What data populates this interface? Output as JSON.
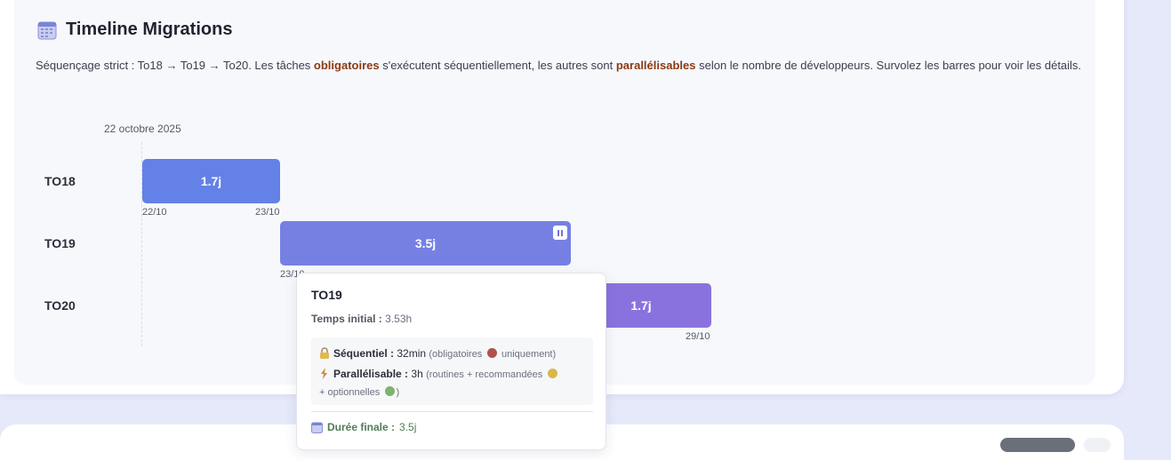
{
  "header": {
    "title": "Timeline Migrations",
    "icon": "calendar-icon"
  },
  "description": {
    "part1": "Séquençage strict : To18 → To19 → To20. Les tâches ",
    "obligatoires": "obligatoires",
    "part2": " s'exécutent séquentiellement, les autres sont ",
    "parallelisables": "parallélisables",
    "part3": " selon le nombre de développeurs. Survolez les barres pour voir les détails."
  },
  "timeline": {
    "start_date": "22 octobre 2025",
    "rows": [
      {
        "label": "TO18",
        "bar_label": "1.7j",
        "color": "#6381e6",
        "start_tick": "22/10",
        "end_tick": "23/10"
      },
      {
        "label": "TO19",
        "bar_label": "3.5j",
        "color": "#7680e3",
        "start_tick": "23/10",
        "pause_icon": "pause-icon"
      },
      {
        "label": "TO20",
        "bar_label": "1.7j",
        "color": "#8a72de",
        "end_tick": "29/10"
      }
    ]
  },
  "tooltip": {
    "title": "TO19",
    "initial_label": "Temps initial :",
    "initial_value": "3.53h",
    "sequential_label": "Séquentiel :",
    "sequential_value": "32min",
    "sequential_note_a": "(obligatoires",
    "sequential_note_b": "uniquement)",
    "parallel_label": "Parallélisable :",
    "parallel_value": "3h",
    "parallel_note_a": "(routines + recommandées",
    "parallel_note_b": "+ optionnelles",
    "parallel_note_c": ")",
    "final_label": "Durée finale :",
    "final_value": "3.5j",
    "colors": {
      "red_dot": "#b0524a",
      "yellow_dot": "#d9b84a",
      "green_dot": "#7db36e"
    }
  }
}
